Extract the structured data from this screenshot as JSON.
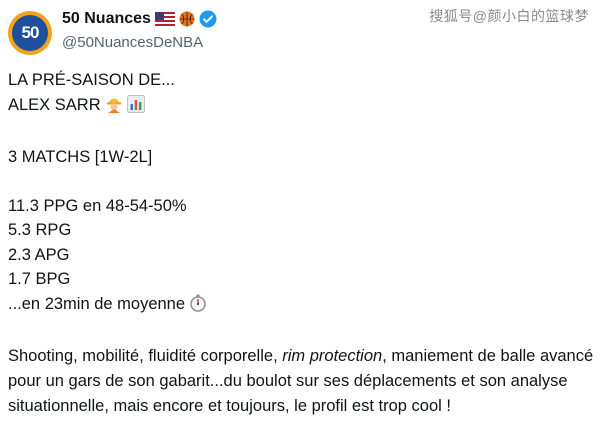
{
  "author": {
    "display_name": "50 Nuances",
    "handle": "@50NuancesDeNBA",
    "avatar_text": "50",
    "badges": [
      "us-flag-icon",
      "basketball-icon",
      "verified-icon"
    ]
  },
  "watermark": "搜狐号@颜小白的篮球梦",
  "tweet": {
    "line1": "LA PRÉ-SAISON DE...",
    "line2": "ALEX SARR",
    "line3": "3 MATCHS [1W-2L]",
    "stat1": "11.3 PPG en 48-54-50%",
    "stat2": "5.3 RPG",
    "stat3": "2.3 APG",
    "stat4": "1.7 BPG",
    "stat5": "...en 23min de moyenne",
    "para_part1": "Shooting, mobilité, fluidité corporelle, ",
    "para_em": "rim protection",
    "para_part2": ", maniement de balle avancé pour un gars de son gabarit...du boulot sur ses déplacements et son analyse situationnelle, mais encore et toujours, le profil est trop cool !"
  },
  "colors": {
    "text": "#0f1419",
    "muted": "#536471",
    "verified": "#1d9bf0",
    "accent": "#1d4f9c"
  }
}
